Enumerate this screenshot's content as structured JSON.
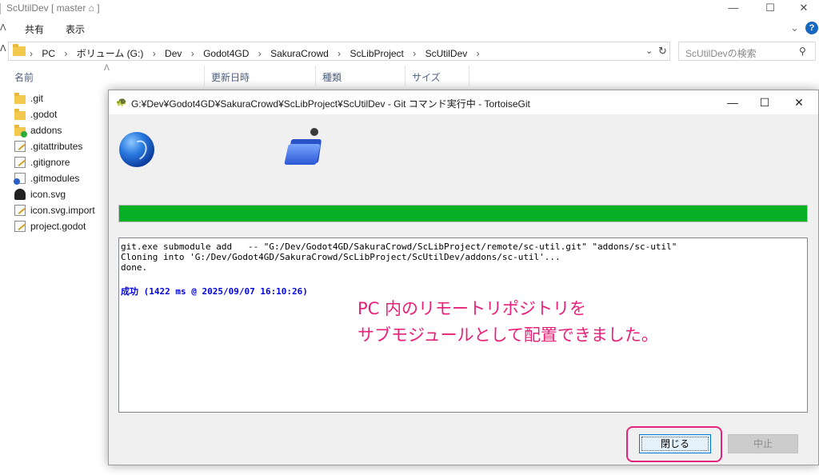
{
  "explorer": {
    "title": "ScUtilDev [ master ⌂ ]",
    "window_buttons": {
      "minimize": "—",
      "maximize": "☐",
      "close": "✕"
    },
    "ribbon": {
      "tabs": [
        "共有",
        "表示"
      ]
    },
    "address": {
      "crumbs": [
        "PC",
        "ボリューム (G:)",
        "Dev",
        "Godot4GD",
        "SakuraCrowd",
        "ScLibProject",
        "ScUtilDev"
      ],
      "separator": "›"
    },
    "search_placeholder": "ScUtilDevの検索",
    "columns": [
      "名前",
      "更新日時",
      "種類",
      "サイズ"
    ],
    "files": [
      {
        "name": ".git",
        "icon": "folder-icon"
      },
      {
        "name": ".godot",
        "icon": "folder-icon"
      },
      {
        "name": "addons",
        "icon": "folder-ok-icon"
      },
      {
        "name": ".gitattributes",
        "icon": "text-file-icon"
      },
      {
        "name": ".gitignore",
        "icon": "text-file-icon"
      },
      {
        "name": ".gitmodules",
        "icon": "modified-file-icon"
      },
      {
        "name": "icon.svg",
        "icon": "svg-file-icon"
      },
      {
        "name": "icon.svg.import",
        "icon": "text-file-icon"
      },
      {
        "name": "project.godot",
        "icon": "text-file-icon"
      }
    ]
  },
  "dialog": {
    "title": "G:¥Dev¥Godot4GD¥SakuraCrowd¥ScLibProject¥ScUtilDev - Git コマンド実行中 - TortoiseGit",
    "progress_percent": 100,
    "progress_color": "#06b025",
    "log_lines": [
      "git.exe submodule add   -- \"G:/Dev/Godot4GD/SakuraCrowd/ScLibProject/remote/sc-util.git\" \"addons/sc-util\"",
      "Cloning into 'G:/Dev/Godot4GD/SakuraCrowd/ScLibProject/ScUtilDev/addons/sc-util'...",
      "done."
    ],
    "success_line": "成功 (1422 ms @ 2025/09/07 16:10:26)",
    "annotation": [
      "PC 内のリモートリポジトリを",
      "サブモジュールとして配置できました。"
    ],
    "buttons": {
      "close": "閉じる",
      "abort": "中止"
    },
    "highlight_color": "#e3237c"
  }
}
